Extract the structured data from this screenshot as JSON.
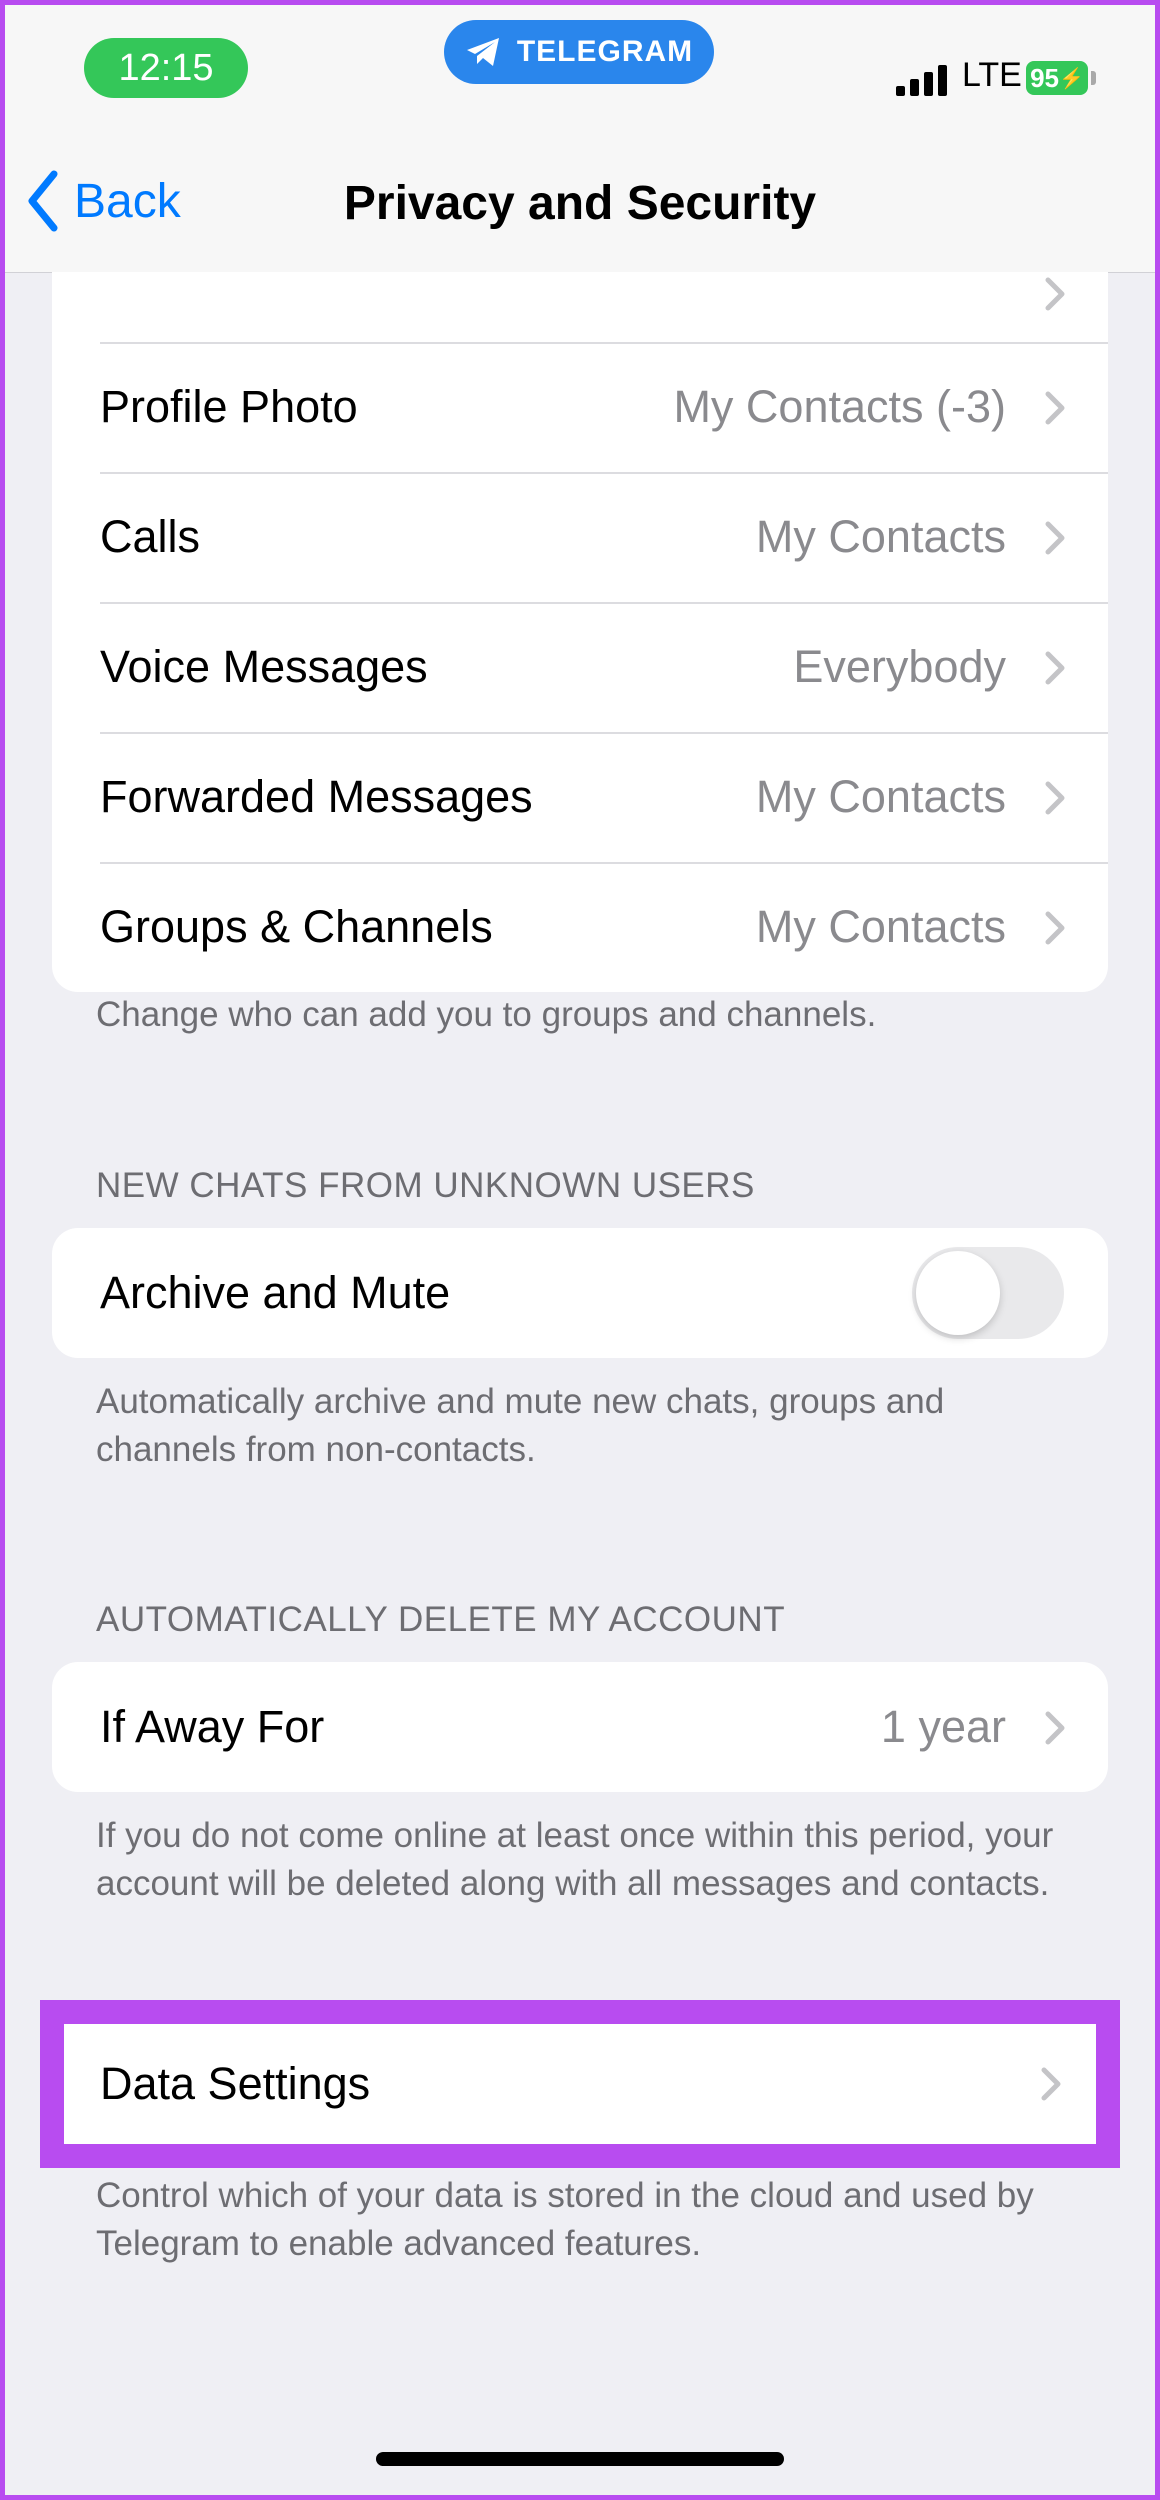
{
  "status_bar": {
    "time": "12:15",
    "app_indicator": "TELEGRAM",
    "network": "LTE",
    "battery": "95"
  },
  "nav": {
    "back_label": "Back",
    "title": "Privacy and Security"
  },
  "privacy_rows": [
    {
      "label": "Profile Photo",
      "value": "My Contacts (-3)"
    },
    {
      "label": "Calls",
      "value": "My Contacts"
    },
    {
      "label": "Voice Messages",
      "value": "Everybody"
    },
    {
      "label": "Forwarded Messages",
      "value": "My Contacts"
    },
    {
      "label": "Groups & Channels",
      "value": "My Contacts"
    }
  ],
  "privacy_footer": "Change who can add you to groups and channels.",
  "new_chats": {
    "header": "NEW CHATS FROM UNKNOWN USERS",
    "archive_label": "Archive and Mute",
    "archive_enabled": false,
    "footer": "Automatically archive and mute new chats, groups and channels from non-contacts."
  },
  "auto_delete": {
    "header": "AUTOMATICALLY DELETE MY ACCOUNT",
    "label": "If Away For",
    "value": "1 year",
    "footer": "If you do not come online at least once within this period, your account will be deleted along with all messages and contacts."
  },
  "data_settings": {
    "label": "Data Settings",
    "footer": "Control which of your data is stored in the cloud and used by Telegram to enable advanced features."
  },
  "colors": {
    "accent": "#007aff",
    "highlight": "#b84cf0",
    "status_green": "#34c759",
    "telegram_blue": "#2a86ec"
  }
}
